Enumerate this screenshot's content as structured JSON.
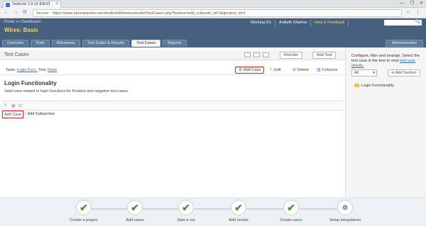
{
  "browser": {
    "tab_title": "TestLink 1.9.16 [DEV]",
    "tab_close": "×",
    "window_controls": [
      "—",
      "❐",
      "✕"
    ],
    "back": "←",
    "forward": "→",
    "reload": "⟳",
    "secure_label": "Secure",
    "url": "https://www.tutorialspoint.com/testlink/lib/testcases/listTestCases.php?feature=edit_tc&node_id=1&tproject_id=1",
    "star": "☆",
    "menu": "⋮"
  },
  "header": {
    "breadcrumb": "Portal >> Dashboard",
    "project_title": "Wires: Basic",
    "links": [
      "Working On",
      "Aniketh Sharma",
      "Help & Feedback"
    ],
    "admin_tab": "Administration",
    "search_icon": "🔍",
    "tabs": [
      "Overview",
      "Tests",
      "Milestones",
      "Test Suites & Results",
      "Test Cases",
      "Reports"
    ],
    "active_tab": "Test Cases"
  },
  "panel": {
    "title": "Test Cases",
    "buttons": [
      "Reorder",
      "Add Test"
    ],
    "nav_left": "Tests:",
    "nav_left_link": "Login Func.",
    "nav_right": "Test: ",
    "nav_right_link": "None",
    "actions": {
      "add_case": "Add Case",
      "edit": "Edit",
      "delete": "Delete",
      "columns": "Columns"
    },
    "section_title": "Login Functionality",
    "section_desc": "Valid case related to login functions for Positive and negative test cases",
    "editor_icons": [
      "≡",
      "▦",
      "⊟"
    ],
    "add_case_link": "Add Case",
    "add_subsection": "Add Subsection",
    "sep": "|"
  },
  "sidebar": {
    "help_text": "Configure, filter and arrange. Select the test case in the tree to view ",
    "help_link": "test case details.",
    "select_value": "All",
    "add_section": "Add Section",
    "tree_item": "Login Functionality"
  },
  "workflow": {
    "steps": [
      {
        "label": "Create a project",
        "icon": "✔"
      },
      {
        "label": "Add cases",
        "icon": "✔"
      },
      {
        "label": "Start a run",
        "icon": "✔"
      },
      {
        "label": "Add results",
        "icon": "✔"
      },
      {
        "label": "Create users",
        "icon": "✔"
      },
      {
        "label": "Setup integrations",
        "icon": "⚙"
      }
    ]
  },
  "colors": {
    "header_bg": "#47607e",
    "highlight_border": "#d62020",
    "title_gold": "#f1d57a",
    "success_green": "#3a9a3a"
  }
}
